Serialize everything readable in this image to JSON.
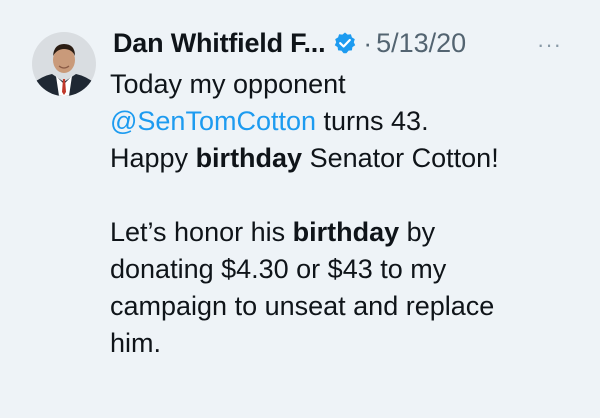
{
  "tweet": {
    "author_name": "Dan Whitfield F...",
    "separator": "·",
    "date": "5/13/20",
    "more_label": "···",
    "line1": "Today my opponent",
    "mention": "@SenTomCotton",
    "line2_rest": " turns 43.",
    "line3_pre": "Happy ",
    "line3_bold": "birthday",
    "line3_post": " Senator Cotton!",
    "line4_pre": "Let’s honor his ",
    "line4_bold": "birthday",
    "line4_post": " by",
    "line5": "donating $4.30 or $43 to my",
    "line6": "campaign to unseat and replace",
    "line7": "him."
  },
  "icons": {
    "verified": "verified-badge-icon",
    "more": "more-options-icon",
    "avatar": "profile-photo"
  },
  "colors": {
    "background": "#eef3f7",
    "text": "#0f1419",
    "secondary": "#536471",
    "link": "#1d9bf0",
    "verified": "#1d9bf0"
  }
}
